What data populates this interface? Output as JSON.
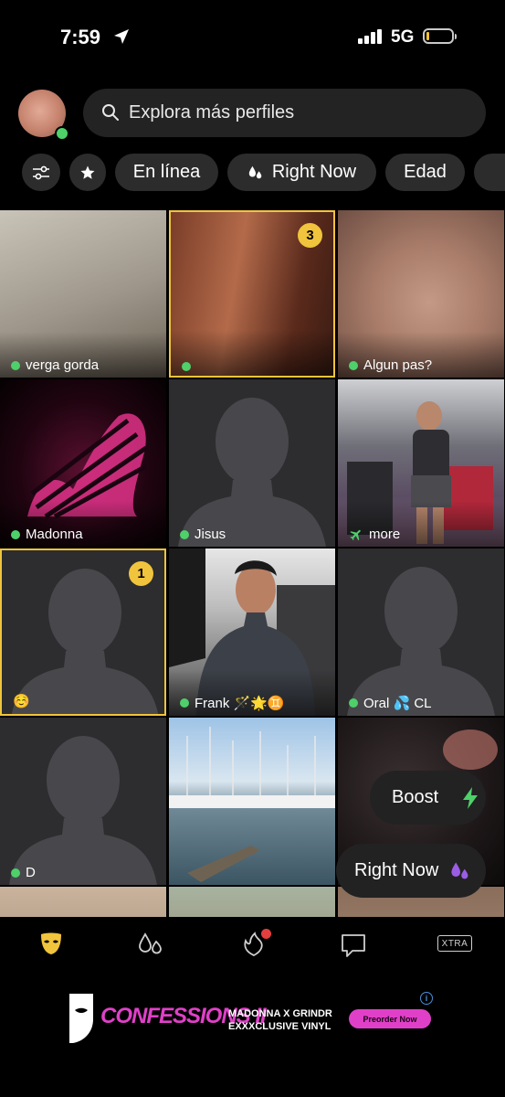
{
  "status_bar": {
    "time": "7:59",
    "network": "5G"
  },
  "search": {
    "placeholder": "Explora más perfiles"
  },
  "filters": {
    "online": "En línea",
    "right_now": "Right Now",
    "age": "Edad"
  },
  "profiles": [
    {
      "name": "verga gorda",
      "online": true
    },
    {
      "name": "",
      "online": true,
      "badge": "3"
    },
    {
      "name": "Algun pas?",
      "online": true
    },
    {
      "name": "Madonna",
      "online": true
    },
    {
      "name": "Jisus",
      "online": true
    },
    {
      "name": "more",
      "online": false
    },
    {
      "name": "☺️",
      "online": false,
      "badge": "1"
    },
    {
      "name": "Frank 🪄🌟♊",
      "online": true
    },
    {
      "name": "Oral  💦 CL",
      "online": true
    },
    {
      "name": "D",
      "online": true
    }
  ],
  "floating": {
    "boost": "Boost",
    "right_now": "Right Now"
  },
  "nav": {
    "xtra": "XTRA"
  },
  "ad": {
    "brand": "CONFESSIONS II",
    "line1": "MADONNA X GRINDR",
    "line2": "EXXXCLUSIVE VINYL",
    "cta": "Preorder Now"
  },
  "colors": {
    "accent": "#f0c43c",
    "online": "#4ed06a",
    "boost": "#4ed06a",
    "right_now": "#9b5de5",
    "ad_pink": "#e040c8"
  }
}
